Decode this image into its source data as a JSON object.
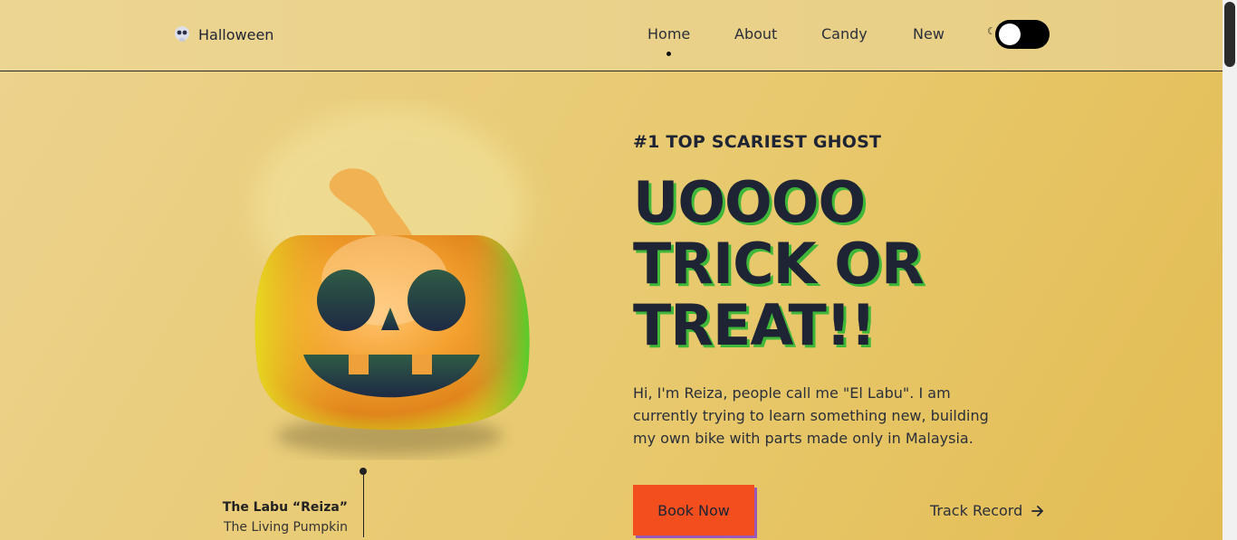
{
  "header": {
    "logo_icon": "skull-icon",
    "logo_text": "Halloween",
    "nav": [
      "Home",
      "About",
      "Candy",
      "New"
    ],
    "active_nav": "Home",
    "toggle_icon": "moon-icon"
  },
  "hero": {
    "subtitle": "#1 TOP SCARIEST GHOST",
    "title_lines": [
      "UOOOO",
      "TRICK OR",
      "TREAT!!"
    ],
    "description": "Hi, I'm Reiza, people call me \"El Labu\". I am currently trying to learn something new, building my own bike with parts made only in Malaysia.",
    "book_button": "Book Now",
    "track_link": "Track Record",
    "track_icon": "arrow-right-icon"
  },
  "caption": {
    "name": "The Labu “Reiza”",
    "subtitle": "The Living Pumpkin"
  },
  "colors": {
    "accent": "#f24e1e",
    "title_shadow": "#3fb83a",
    "button_shadow": "#9b59b6",
    "text": "#1e2433"
  }
}
